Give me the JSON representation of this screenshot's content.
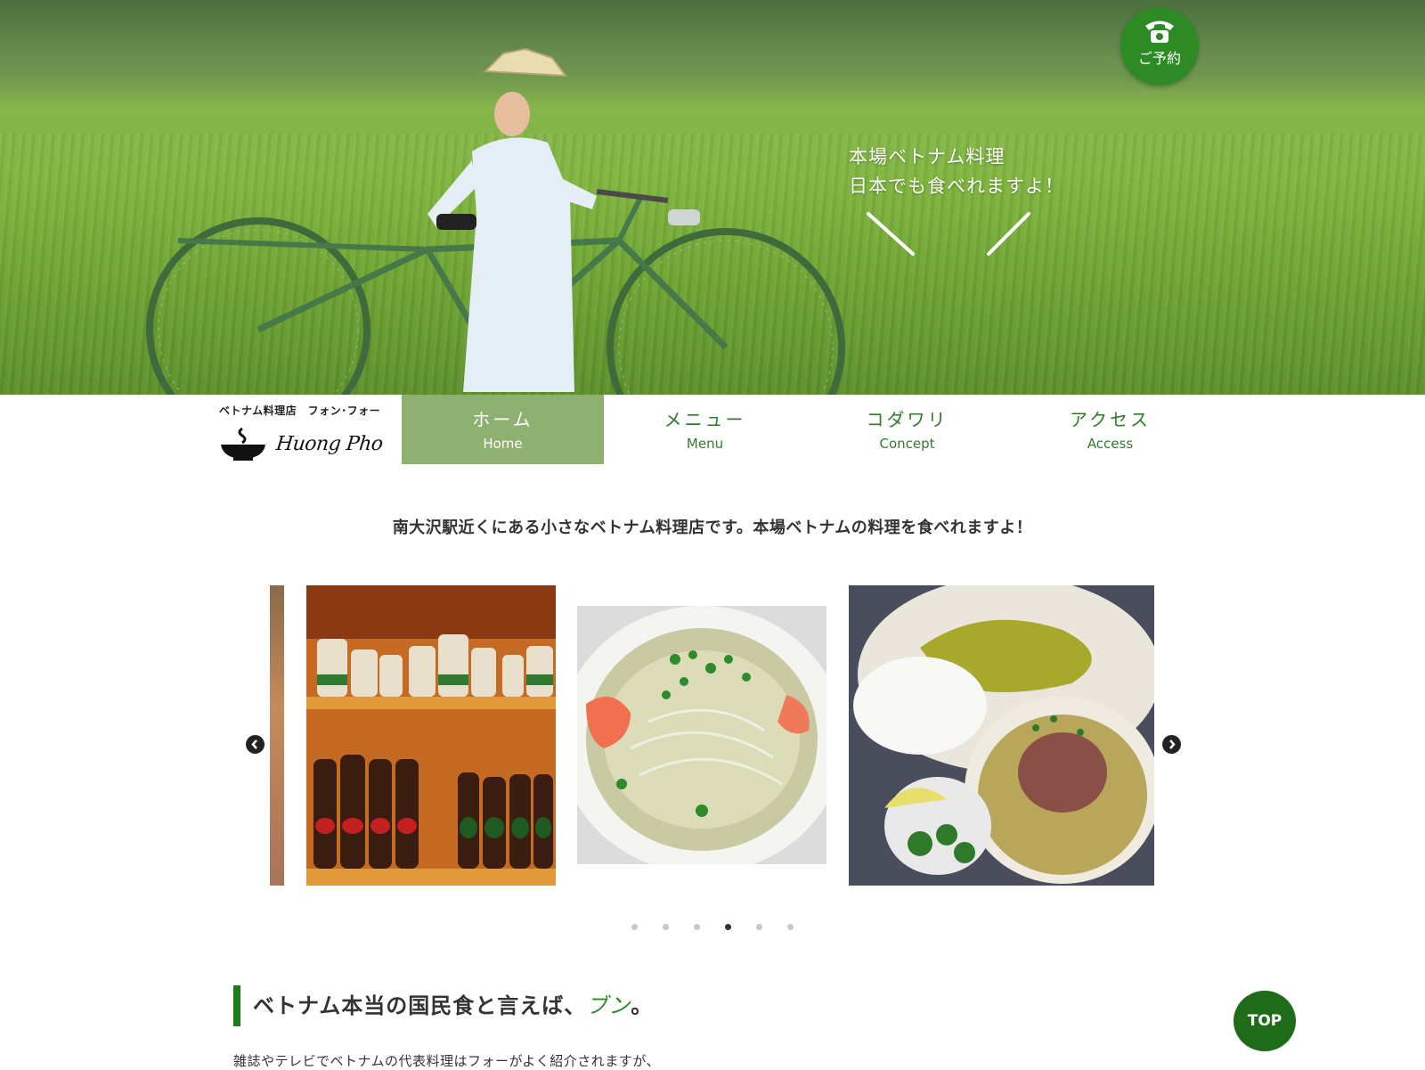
{
  "hero": {
    "copy_line1": "本場ベトナム料理",
    "copy_line2": "日本でも食べれますよ！",
    "reserve_label": "ご予約"
  },
  "brand": {
    "subtitle": "ベトナム料理店　フォン･フォー",
    "logo_text": "Huong Pho"
  },
  "nav": {
    "items": [
      {
        "jp": "ホーム",
        "en": "Home",
        "active": true
      },
      {
        "jp": "メニュー",
        "en": "Menu",
        "active": false
      },
      {
        "jp": "コダワリ",
        "en": "Concept",
        "active": false
      },
      {
        "jp": "アクセス",
        "en": "Access",
        "active": false
      }
    ]
  },
  "intro": {
    "text": "南大沢駅近くにある小さなベトナム料理店です。本場ベトナムの料理を食べれますよ！"
  },
  "carousel": {
    "slide_count": 6,
    "active_index": 3,
    "slides": [
      "shelf-of-drinks",
      "seafood-noodle-soup",
      "pho-and-curry-set"
    ]
  },
  "section": {
    "title_main": "ベトナム本当の国民食と言えば、",
    "title_accent": "ブン",
    "title_end": "。",
    "body": "雑誌やテレビでベトナムの代表料理はフォーがよく紹介されますが、"
  },
  "top_button": {
    "label": "TOP"
  },
  "colors": {
    "nav_active": "#8eb070",
    "nav_text": "#2f7d2a",
    "reserve_button": "#2d8a25",
    "top_button": "#1e6b1a",
    "section_bar": "#1e7d18"
  }
}
